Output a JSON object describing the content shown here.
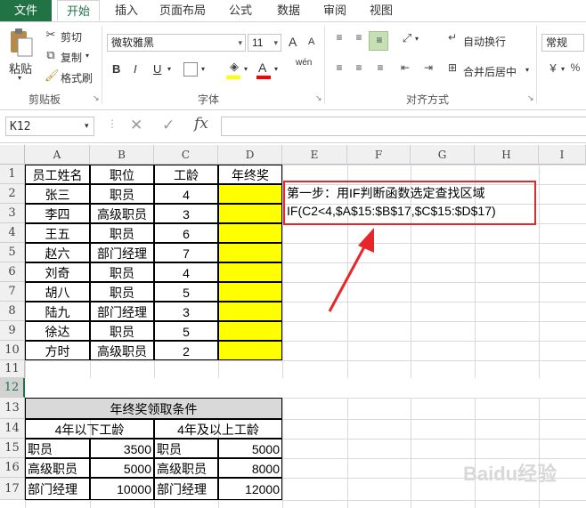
{
  "tabs": [
    "文件",
    "开始",
    "插入",
    "页面布局",
    "公式",
    "数据",
    "审阅",
    "视图"
  ],
  "ribbon": {
    "clipboard": {
      "paste": "粘贴",
      "cut": "剪切",
      "copy": "复制",
      "format_painter": "格式刷",
      "label": "剪贴板"
    },
    "font": {
      "name": "微软雅黑",
      "size": "11",
      "bold": "B",
      "italic": "I",
      "underline": "U",
      "label": "字体",
      "grow": "A",
      "shrink": "A",
      "wen": "wén"
    },
    "alignment": {
      "wrap": "自动换行",
      "merge": "合并后居中",
      "label": "对齐方式"
    },
    "number": {
      "format": "常规"
    }
  },
  "formula_bar": {
    "name_box": "K12",
    "fx": "fx",
    "cancel": "✕",
    "enter": "✓",
    "content": ""
  },
  "columns": [
    "A",
    "B",
    "C",
    "D",
    "E",
    "F",
    "G",
    "H",
    "I"
  ],
  "rows": [
    "1",
    "2",
    "3",
    "4",
    "5",
    "6",
    "7",
    "8",
    "9",
    "10",
    "11",
    "12",
    "13",
    "14",
    "15",
    "16",
    "17"
  ],
  "table1": {
    "headers": [
      "员工姓名",
      "职位",
      "工龄",
      "年终奖"
    ],
    "rows": [
      [
        "张三",
        "职员",
        "4"
      ],
      [
        "李四",
        "高级职员",
        "3"
      ],
      [
        "王五",
        "职员",
        "6"
      ],
      [
        "赵六",
        "部门经理",
        "7"
      ],
      [
        "刘奇",
        "职员",
        "4"
      ],
      [
        "胡八",
        "职员",
        "5"
      ],
      [
        "陆九",
        "部门经理",
        "3"
      ],
      [
        "徐达",
        "职员",
        "5"
      ],
      [
        "方时",
        "高级职员",
        "2"
      ]
    ]
  },
  "table2": {
    "title": "年终奖领取条件",
    "left_header": "4年以下工龄",
    "right_header": "4年及以上工龄",
    "rows": [
      [
        "职员",
        "3500",
        "职员",
        "5000"
      ],
      [
        "高级职员",
        "5000",
        "高级职员",
        "8000"
      ],
      [
        "部门经理",
        "10000",
        "部门经理",
        "12000"
      ]
    ]
  },
  "annotation": {
    "line1": "第一步：用IF判断函数选定查找区域",
    "line2": "IF(C2<4,$A$15:$B$17,$C$15:$D$17)",
    "border_color": "#e8262a"
  },
  "colors": {
    "excel_green": "#217346",
    "highlight": "#ffff00",
    "header_fill": "#d9d9d9"
  },
  "watermark": "Baidu经验"
}
